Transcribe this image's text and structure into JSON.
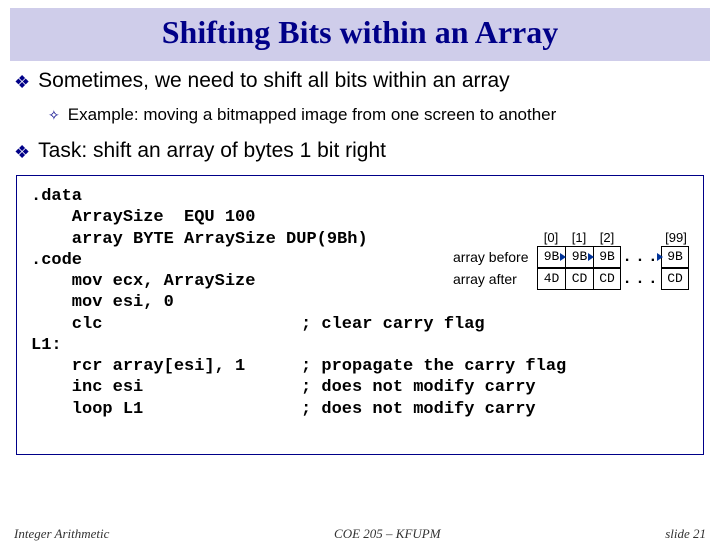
{
  "title": "Shifting Bits within an Array",
  "bullet1": "Sometimes, we need to shift all bits within an array",
  "sub1": "Example: moving a bitmapped image from one screen to another",
  "bullet2": "Task: shift an array of bytes 1 bit right",
  "code": {
    "l1": ".data",
    "l2": "    ArraySize  EQU 100",
    "l3": "    array BYTE ArraySize DUP(9Bh)",
    "l4": ".code",
    "l5": "    mov ecx, ArraySize",
    "l6": "    mov esi, 0",
    "l7": "    clc",
    "c7": "; clear carry flag",
    "l8": "L1:",
    "l9": "    rcr array[esi], 1",
    "c9": "; propagate the carry flag",
    "l10": "    inc esi",
    "c10": "; does not modify carry",
    "l11": "    loop L1",
    "c11": "; does not modify carry"
  },
  "diagram": {
    "idx0": "[0]",
    "idx1": "[1]",
    "idx2": "[2]",
    "idx99": "[99]",
    "label_before": "array before",
    "label_after": "array after",
    "dots": ". . .",
    "before": {
      "c0": "9B",
      "c1": "9B",
      "c2": "9B",
      "c99": "9B"
    },
    "after": {
      "c0": "4D",
      "c1": "CD",
      "c2": "CD",
      "c99": "CD"
    }
  },
  "footer": {
    "left": "Integer Arithmetic",
    "mid": "COE 205 – KFUPM",
    "right": "slide 21"
  }
}
